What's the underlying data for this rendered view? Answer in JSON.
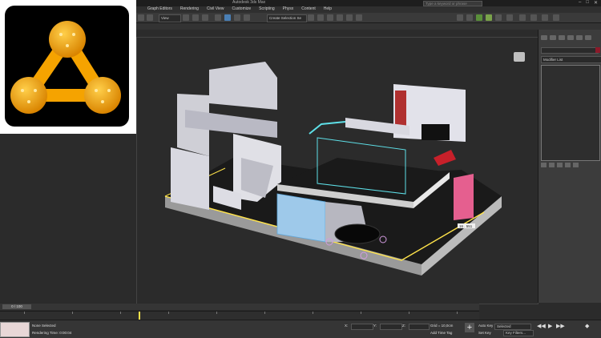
{
  "window": {
    "title": "Autodesk 3ds Max",
    "search_placeholder": "Type a keyword or phrase"
  },
  "menu": {
    "items": [
      "Graph Editors",
      "Rendering",
      "Civil View",
      "Customize",
      "Scripting",
      "Physx",
      "Content",
      "Help"
    ]
  },
  "toolbar": {
    "view_dropdown": "View",
    "selection_set": "Create Selection Se"
  },
  "command_panel": {
    "modifier_list": "Modifier List"
  },
  "viewport": {
    "dimension_label": "16 . 551"
  },
  "timeline": {
    "frame_counter": "0 / 100"
  },
  "status": {
    "selection_text": "None Selected",
    "render_time_label": "Rendering Time: 0:00:04",
    "x_label": "X:",
    "y_label": "Y:",
    "z_label": "Z:",
    "grid_label": "Grid = 10,0cm",
    "add_time_tag": "Add Time Tag",
    "auto_key": "Auto Key",
    "set_key": "Set Key",
    "selected_dropdown": "Selected",
    "key_filters": "Key Filters..."
  },
  "colors": {
    "accent_yellow": "#ffe34a",
    "cyan_select": "#5ee0e8",
    "logo_orange": "#f5a300"
  },
  "icons": [
    "logo-icon",
    "viewcube-icon",
    "play-icon",
    "prev-frame-icon",
    "next-frame-icon",
    "key-icon"
  ]
}
